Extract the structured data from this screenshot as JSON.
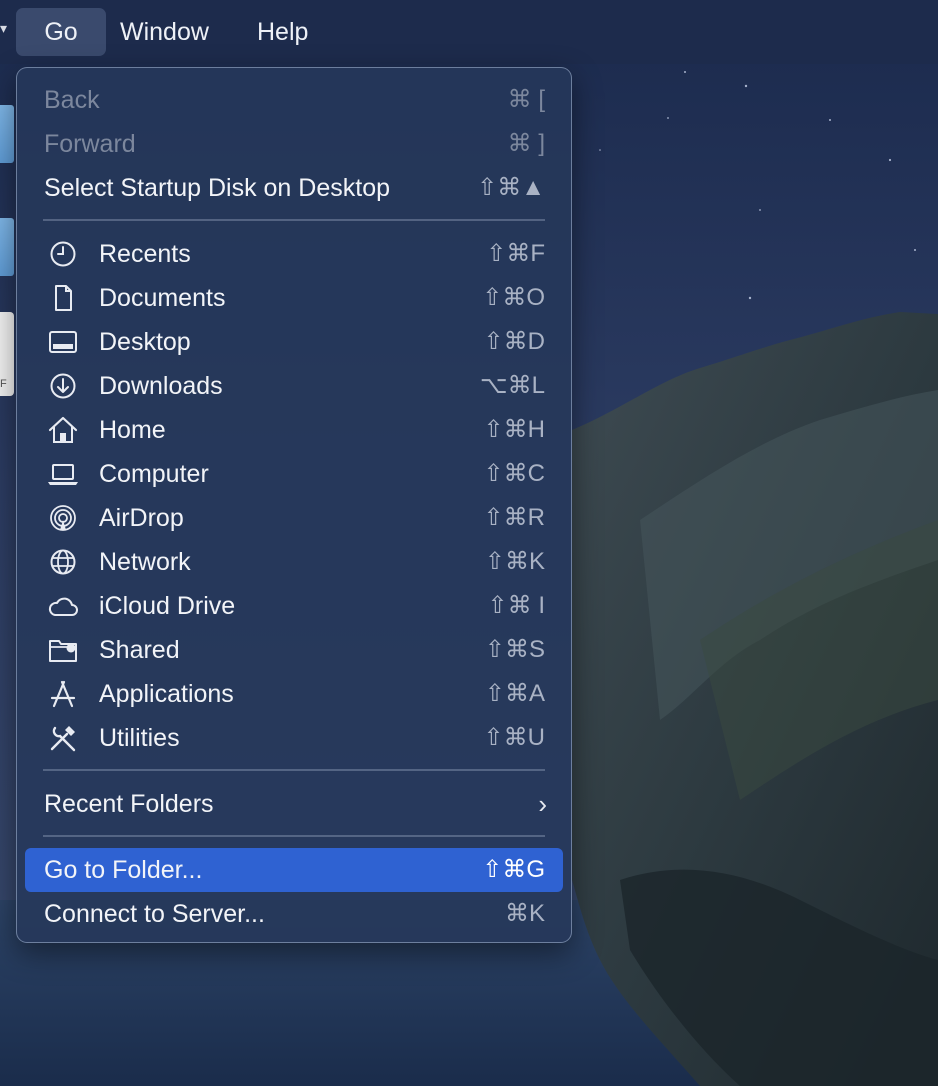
{
  "menubar": {
    "items": [
      {
        "label": "Go",
        "active": true
      },
      {
        "label": "Window",
        "active": false
      },
      {
        "label": "Help",
        "active": false
      }
    ]
  },
  "desktop": {
    "doc_fragment": "F"
  },
  "go_menu": {
    "top_items": [
      {
        "label": "Back",
        "shortcut": "⌘ [",
        "enabled": false
      },
      {
        "label": "Forward",
        "shortcut": "⌘ ]",
        "enabled": false
      },
      {
        "label": "Select Startup Disk on Desktop",
        "shortcut": "⇧⌘▲",
        "enabled": true
      }
    ],
    "places": [
      {
        "label": "Recents",
        "shortcut": "⇧⌘F",
        "icon": "clock-icon"
      },
      {
        "label": "Documents",
        "shortcut": "⇧⌘O",
        "icon": "document-icon"
      },
      {
        "label": "Desktop",
        "shortcut": "⇧⌘D",
        "icon": "desktop-icon"
      },
      {
        "label": "Downloads",
        "shortcut": "⌥⌘L",
        "icon": "download-icon"
      },
      {
        "label": "Home",
        "shortcut": "⇧⌘H",
        "icon": "home-icon"
      },
      {
        "label": "Computer",
        "shortcut": "⇧⌘C",
        "icon": "laptop-icon"
      },
      {
        "label": "AirDrop",
        "shortcut": "⇧⌘R",
        "icon": "airdrop-icon"
      },
      {
        "label": "Network",
        "shortcut": "⇧⌘K",
        "icon": "globe-icon"
      },
      {
        "label": "iCloud Drive",
        "shortcut": "⇧⌘ I",
        "icon": "cloud-icon"
      },
      {
        "label": "Shared",
        "shortcut": "⇧⌘S",
        "icon": "shared-folder-icon"
      },
      {
        "label": "Applications",
        "shortcut": "⇧⌘A",
        "icon": "applications-icon"
      },
      {
        "label": "Utilities",
        "shortcut": "⇧⌘U",
        "icon": "utilities-icon"
      }
    ],
    "recent_folders": {
      "label": "Recent Folders",
      "arrow": "›"
    },
    "bottom_items": [
      {
        "label": "Go to Folder...",
        "shortcut": "⇧⌘G",
        "highlighted": true
      },
      {
        "label": "Connect to Server...",
        "shortcut": "⌘K",
        "highlighted": false
      }
    ]
  },
  "colors": {
    "menu_background": "#26385a",
    "highlight": "#2f62d2",
    "menubar": "#1d2b4c",
    "text": "#f2f4f8",
    "disabled_text": "#7c879d",
    "shortcut_text": "#a9b2c4"
  }
}
